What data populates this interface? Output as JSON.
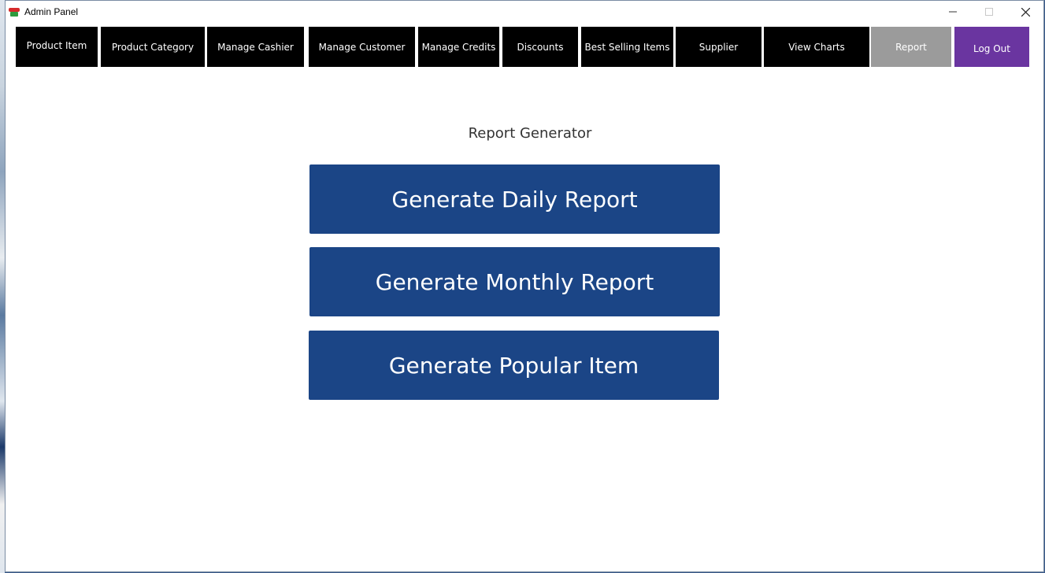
{
  "window": {
    "title": "Admin Panel"
  },
  "nav": {
    "items": [
      {
        "label": "Product Item"
      },
      {
        "label": "Product Category"
      },
      {
        "label": "Manage Cashier"
      },
      {
        "label": "Manage Customer"
      },
      {
        "label": "Manage Credits"
      },
      {
        "label": "Discounts"
      },
      {
        "label": "Best Selling Items"
      },
      {
        "label": "Supplier"
      },
      {
        "label": "View Charts"
      },
      {
        "label": "Report"
      },
      {
        "label": "Log Out"
      }
    ],
    "active": "Report"
  },
  "main": {
    "heading": "Report Generator",
    "buttons": [
      {
        "label": "Generate Daily Report"
      },
      {
        "label": "Generate Monthly Report"
      },
      {
        "label": "Generate Popular Item"
      }
    ]
  },
  "colors": {
    "nav_bg": "#000000",
    "nav_active": "#9b9b9b",
    "logout_bg": "#6a35a0",
    "action_button": "#1b4586"
  },
  "icons": {
    "app": "app-logo-icon",
    "minimize": "minimize-icon",
    "maximize": "maximize-icon",
    "close": "close-icon"
  }
}
